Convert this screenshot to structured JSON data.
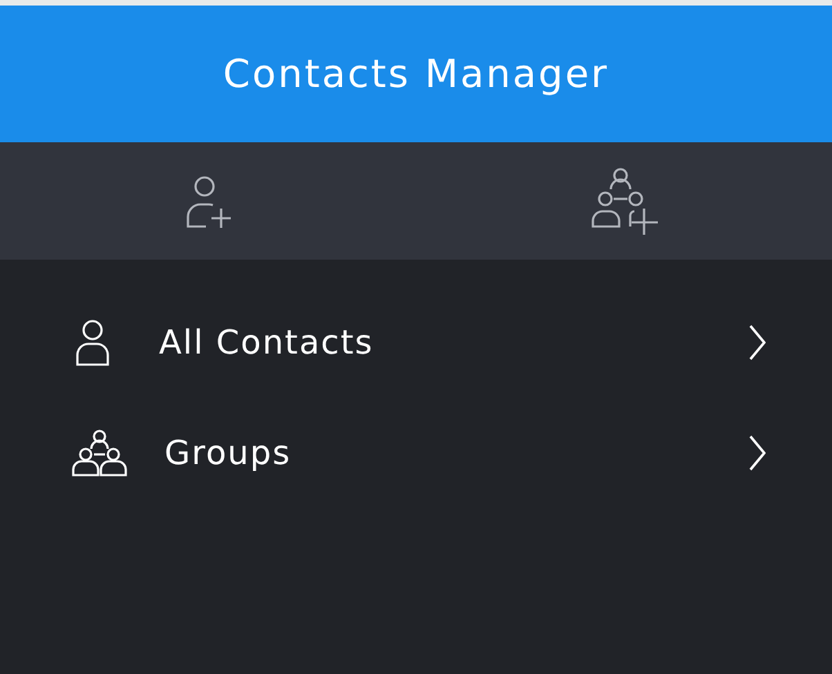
{
  "header": {
    "title": "Contacts Manager"
  },
  "toolbar": [
    {
      "kind": "add-person"
    },
    {
      "kind": "add-group"
    }
  ],
  "menu": [
    {
      "label": "All Contacts",
      "kind": "person"
    },
    {
      "label": "Groups",
      "kind": "group"
    }
  ]
}
